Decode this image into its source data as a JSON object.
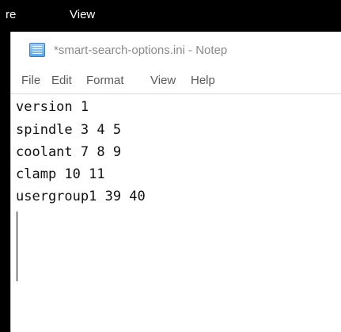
{
  "background_app": {
    "menu": [
      "re",
      "View"
    ]
  },
  "window": {
    "icon": "notepad-icon",
    "title": "*smart-search-options.ini - Notep"
  },
  "menu": [
    "File",
    "Edit",
    "Format",
    "View",
    "Help"
  ],
  "document": {
    "lines": [
      "version 1",
      "spindle 3 4 5",
      "coolant 7 8 9",
      "clamp 10 11",
      "usergroup1 39 40"
    ]
  }
}
